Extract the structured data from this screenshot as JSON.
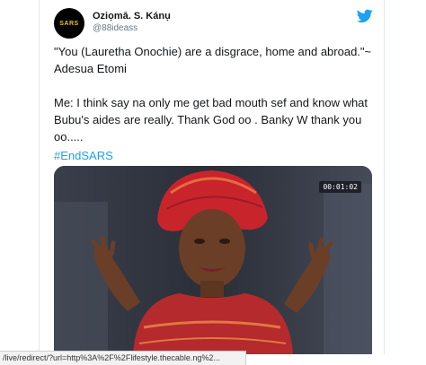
{
  "tweet": {
    "avatar_text": "SARS",
    "author_name": "Oziọmā. S. Kánụ",
    "author_handle": "@88ideass",
    "text": "\"You (Lauretha Onochie) are a disgrace, home and abroad.\"~ Adesua Etomi\n\nMe: I think say na only me get bad mouth sef and know what Bubu's aides are really. Thank God oo . Banky W thank you oo.....",
    "hashtag": "#EndSARS",
    "media_timer": "00:01:02"
  },
  "statusbar": {
    "url": "/live/redirect/?url=http%3A%2F%2Flifestyle.thecable.ng%2..."
  },
  "colors": {
    "link": "#1da1f2",
    "text": "#14171a",
    "secondary": "#657786"
  },
  "icons": [
    "twitter-bird-icon"
  ]
}
